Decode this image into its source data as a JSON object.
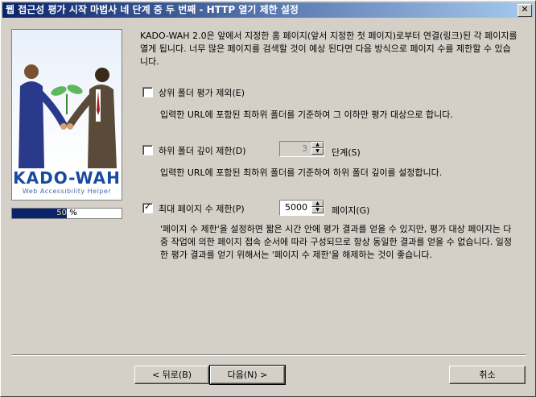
{
  "window": {
    "title": "웹 접근성 평가 시작 마법사 네 단계 중 두 번째 - HTTP 열기 제한 설정",
    "close_glyph": "✕"
  },
  "banner": {
    "logo": "KADO-WAH",
    "logo_subtitle": "Web Accessibility Helper"
  },
  "progress": {
    "value": 0.5,
    "label": "50 %"
  },
  "description": "KADO-WAH 2.0은 앞에서 지정한 홈 페이지(앞서 지정한 첫 페이지)로부터 연결(링크)된 각 페이지를 열게 됩니다. 너무 많은 페이지를 검색할 것이 예상 된다면 다음 방식으로 페이지 수를 제한할 수 있습니다.",
  "options": {
    "exclude_parent": {
      "label": "상위 폴더 평가 제외(E)",
      "checked": false,
      "help": "입력한 URL에 포함된 최하위 폴더를 기준하여 그 이하만 평가 대상으로 합니다."
    },
    "limit_depth": {
      "label": "하위 폴더 깊이 제한(D)",
      "checked": false,
      "value": "3",
      "unit": "단계(S)",
      "help": "입력한 URL에 포함된 최하위 폴더를 기준하여 하위 폴더 깊이를 설정합니다."
    },
    "limit_pages": {
      "label": "최대 페이지 수 제한(P)",
      "checked": true,
      "value": "5000",
      "unit": "페이지(G)",
      "help": "'페이지 수 제한'을 설정하면 짧은 시간 안에 평가 결과를 얻을 수 있지만, 평가 대상 페이지는 다중 작업에 의한 페이지 접속 순서에 따라 구성되므로 항상 동일한 결과를 얻을 수 없습니다. 일정한 평가 결과를 얻기 위해서는 '페이지 수 제한'을 해제하는 것이 좋습니다."
    }
  },
  "buttons": {
    "back": "< 뒤로(B)",
    "next": "다음(N) >",
    "cancel": "취소"
  }
}
